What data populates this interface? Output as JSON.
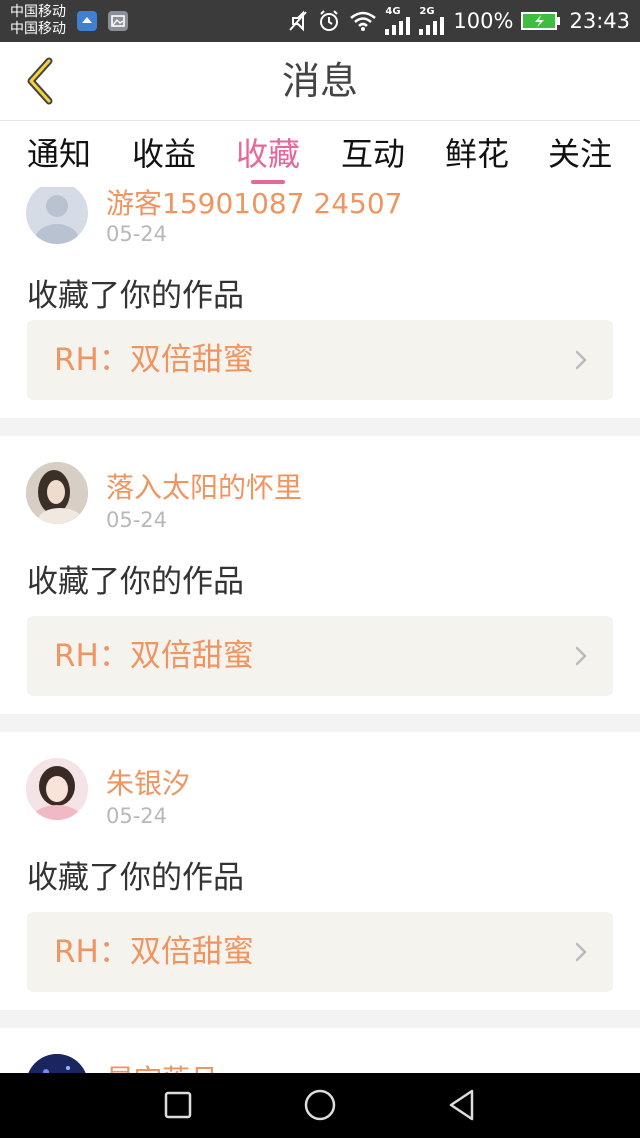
{
  "status_bar": {
    "carrier_1": "中国移动",
    "carrier_2": "中国移动",
    "network_1": "4G",
    "network_2": "2G",
    "battery": "100%",
    "time": "23:43"
  },
  "header": {
    "title": "消息",
    "back_icon": "chevron-left-icon"
  },
  "tabs": [
    {
      "label": "通知",
      "active": false
    },
    {
      "label": "收益",
      "active": false
    },
    {
      "label": "收藏",
      "active": true
    },
    {
      "label": "互动",
      "active": false
    },
    {
      "label": "鲜花",
      "active": false
    },
    {
      "label": "关注",
      "active": false
    }
  ],
  "messages": [
    {
      "username": "游客15901087 24507",
      "date": "05-24",
      "action": "收藏了你的作品",
      "work": "RH：双倍甜蜜"
    },
    {
      "username": "落入太阳的怀里",
      "date": "05-24",
      "action": "收藏了你的作品",
      "work": "RH：双倍甜蜜"
    },
    {
      "username": "朱银汐",
      "date": "05-24",
      "action": "收藏了你的作品",
      "work": "RH：双倍甜蜜"
    },
    {
      "username": "星空落月",
      "date": "",
      "action": "",
      "work": ""
    }
  ],
  "colors": {
    "accent_pink": "#e8679b",
    "name_orange": "#ef9560",
    "link_bg": "#f5f3ee"
  },
  "nav_bar": {
    "recent_icon": "square-icon",
    "home_icon": "circle-icon",
    "back_icon": "triangle-back-icon"
  }
}
